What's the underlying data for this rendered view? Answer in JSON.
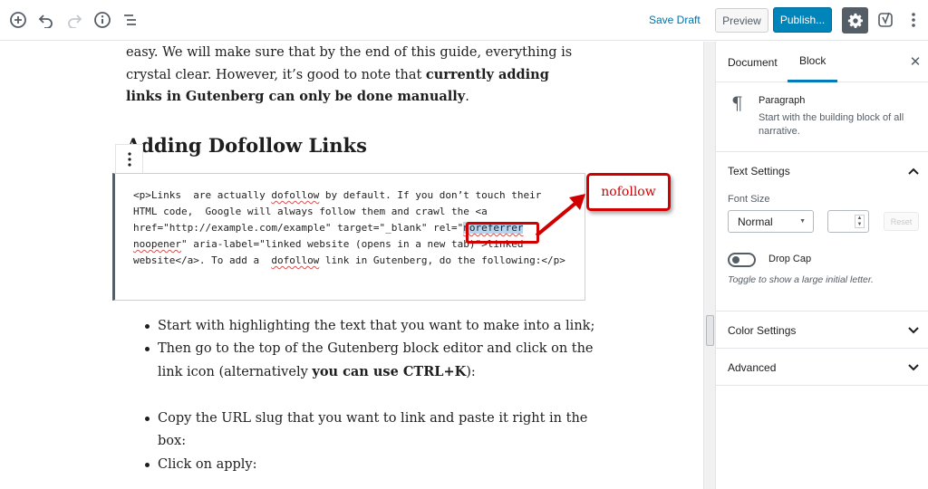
{
  "toolbar": {
    "save_draft": "Save Draft",
    "preview": "Preview",
    "publish": "Publish...",
    "icons": [
      "add-block-icon",
      "undo-icon",
      "redo-icon",
      "info-icon",
      "outline-icon",
      "gear-icon",
      "yoast-icon",
      "more-vertical-icon"
    ]
  },
  "content": {
    "intro": [
      {
        "text": "easy. We will make sure that by the end of this guide,  everything is crystal clear. However, it’s good to note that ",
        "bold": false
      },
      {
        "text": "currently adding links in Gutenberg can only be done manually",
        "bold": true
      },
      {
        "text": ".",
        "bold": false
      }
    ],
    "heading": "Adding Dofollow Links",
    "code": [
      {
        "t": "<p>Links  are actually ",
        "s": ""
      },
      {
        "t": "dofollow",
        "s": "sq"
      },
      {
        "t": " by default. If you don’t touch their HTML code,  Google will always follow them and crawl the <a href=\"http://example.com/example\" target=\"_blank\" rel=\"",
        "s": ""
      },
      {
        "t": "noreferrer",
        "s": "hl sq"
      },
      {
        "t": "\n",
        "s": ""
      },
      {
        "t": "noopener",
        "s": "sq"
      },
      {
        "t": "\" aria-label=\"linked website (opens in a new tab)\">linked website</a>. To add a  ",
        "s": ""
      },
      {
        "t": "dofollow",
        "s": "sq"
      },
      {
        "t": " link in Gutenberg, do the following:</p>",
        "s": ""
      }
    ],
    "callout": "nofollow",
    "list1": [
      "Start with highlighting the text that you want to make into a link;"
    ],
    "list2_plain": "Then go to the top of the Gutenberg block editor and click on the link icon (alternatively ",
    "list2_bold": "you can use CTRL+K",
    "list2_end": "):",
    "list3": "Copy the URL slug that you want to link and paste it right in the box:",
    "list4": "Click on apply:"
  },
  "sidebar": {
    "tab_document": "Document",
    "tab_block": "Block",
    "block_title": "Paragraph",
    "block_desc": "Start with the building block of all narrative.",
    "text_settings": "Text Settings",
    "font_size_label": "Font Size",
    "font_size_value": "Normal",
    "reset": "Reset",
    "drop_cap": "Drop Cap",
    "drop_cap_help": "Toggle to show a large initial letter.",
    "color_settings": "Color Settings",
    "advanced": "Advanced"
  }
}
